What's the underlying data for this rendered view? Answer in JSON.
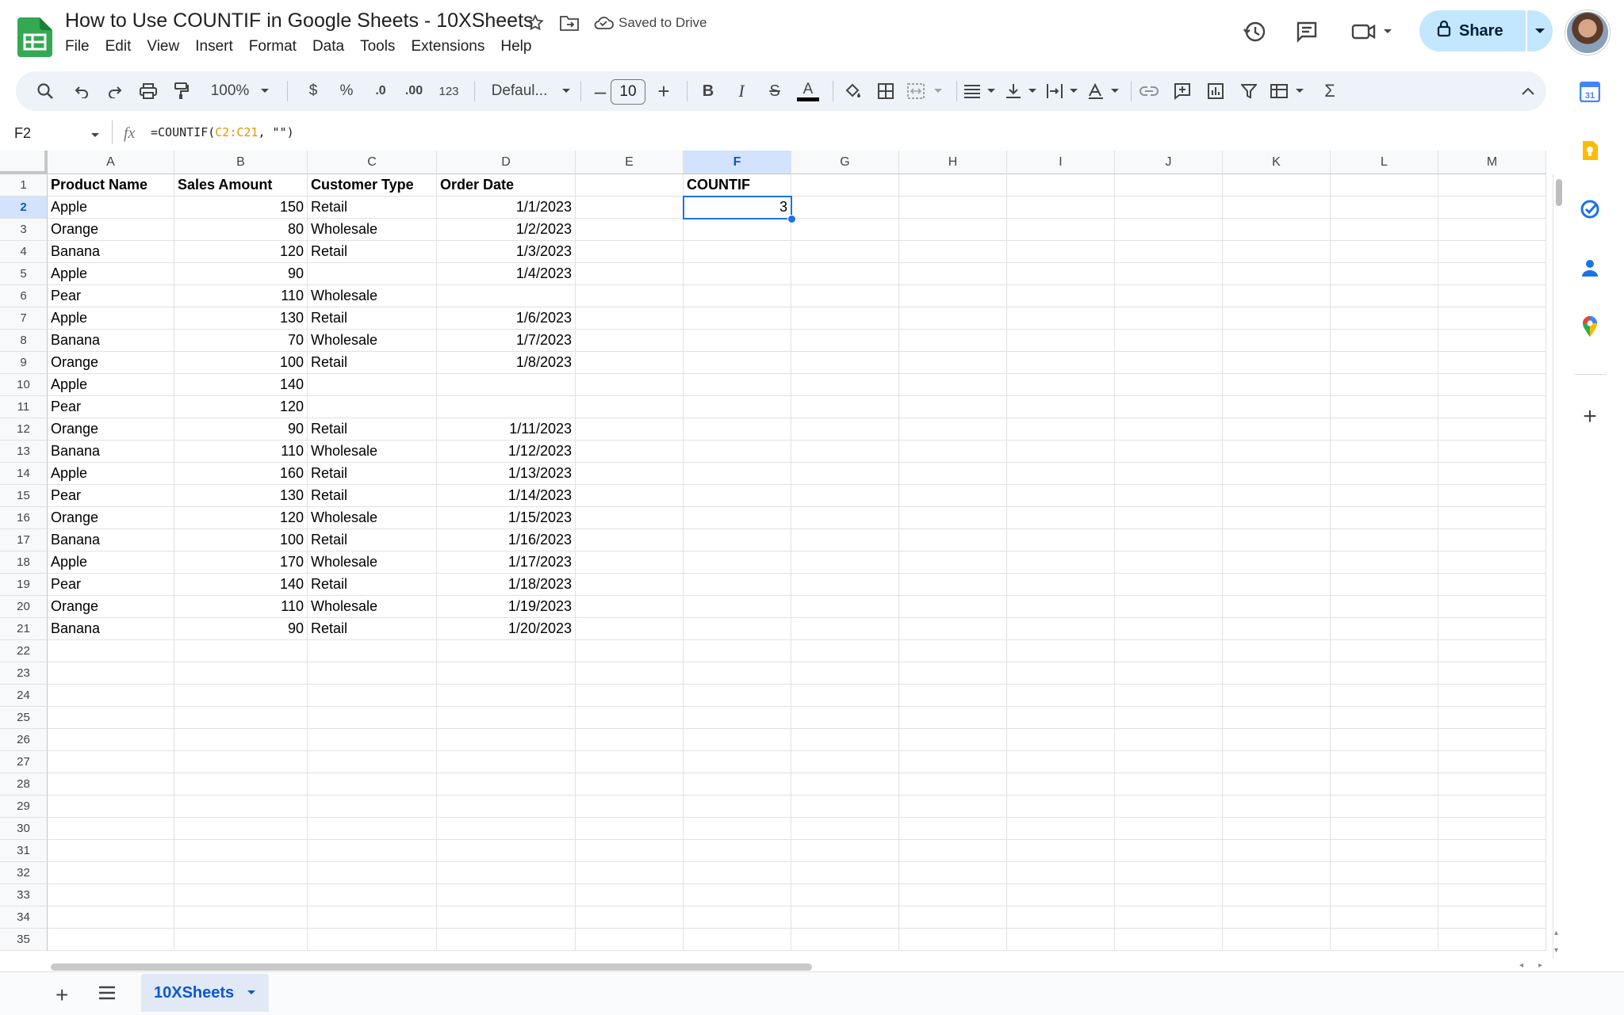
{
  "app": {
    "title": "How to Use COUNTIF in Google Sheets - 10XSheets",
    "saved_status": "Saved to Drive",
    "share_label": "Share"
  },
  "menu": [
    "File",
    "Edit",
    "View",
    "Insert",
    "Format",
    "Data",
    "Tools",
    "Extensions",
    "Help"
  ],
  "toolbar": {
    "zoom": "100%",
    "currency": "$",
    "percent": "%",
    "dec_decrease": ".0",
    "dec_increase": ".00",
    "number_format": "123",
    "font": "Defaul...",
    "font_size": "10",
    "bold": "B",
    "italic": "I",
    "strike": "S",
    "text_color_glyph": "A",
    "text_color": "#000000"
  },
  "formula_bar": {
    "name_box": "F2",
    "formula_prefix": "=COUNTIF(",
    "formula_ref": "C2:C21",
    "formula_suffix": ", \"\")"
  },
  "grid": {
    "columns": [
      "A",
      "B",
      "C",
      "D",
      "E",
      "F",
      "G",
      "H",
      "I",
      "J",
      "K",
      "L",
      "M"
    ],
    "selected_column": "F",
    "selected_row": 2,
    "row_numbers": [
      1,
      2,
      3,
      4,
      5,
      6,
      7,
      8,
      9,
      10,
      11,
      12,
      13,
      14,
      15,
      16,
      17,
      18,
      19,
      20,
      21,
      22,
      23,
      24,
      25,
      26,
      27,
      28,
      29,
      30,
      31,
      32,
      33,
      34,
      35
    ],
    "headers": [
      "Product Name",
      "Sales Amount",
      "Customer Type",
      "Order Date"
    ],
    "countif_header": "COUNTIF",
    "countif_value": "3",
    "rows": [
      [
        "Apple",
        "150",
        "Retail",
        "1/1/2023"
      ],
      [
        "Orange",
        "80",
        "Wholesale",
        "1/2/2023"
      ],
      [
        "Banana",
        "120",
        "Retail",
        "1/3/2023"
      ],
      [
        "Apple",
        "90",
        "",
        "1/4/2023"
      ],
      [
        "Pear",
        "110",
        "Wholesale",
        ""
      ],
      [
        "Apple",
        "130",
        "Retail",
        "1/6/2023"
      ],
      [
        "Banana",
        "70",
        "Wholesale",
        "1/7/2023"
      ],
      [
        "Orange",
        "100",
        "Retail",
        "1/8/2023"
      ],
      [
        "Apple",
        "140",
        "",
        ""
      ],
      [
        "Pear",
        "120",
        "",
        ""
      ],
      [
        "Orange",
        "90",
        "Retail",
        "1/11/2023"
      ],
      [
        "Banana",
        "110",
        "Wholesale",
        "1/12/2023"
      ],
      [
        "Apple",
        "160",
        "Retail",
        "1/13/2023"
      ],
      [
        "Pear",
        "130",
        "Retail",
        "1/14/2023"
      ],
      [
        "Orange",
        "120",
        "Wholesale",
        "1/15/2023"
      ],
      [
        "Banana",
        "100",
        "Retail",
        "1/16/2023"
      ],
      [
        "Apple",
        "170",
        "Wholesale",
        "1/17/2023"
      ],
      [
        "Pear",
        "140",
        "Retail",
        "1/18/2023"
      ],
      [
        "Orange",
        "110",
        "Wholesale",
        "1/19/2023"
      ],
      [
        "Banana",
        "90",
        "Retail",
        "1/20/2023"
      ]
    ]
  },
  "sheet_tabs": [
    {
      "label": "10XSheets",
      "active": true
    }
  ],
  "colors": {
    "accent": "#1a73e8",
    "share_bg": "#c2e7ff",
    "toolbar_bg": "#eef2f9",
    "formula_ref": "#e69500"
  }
}
